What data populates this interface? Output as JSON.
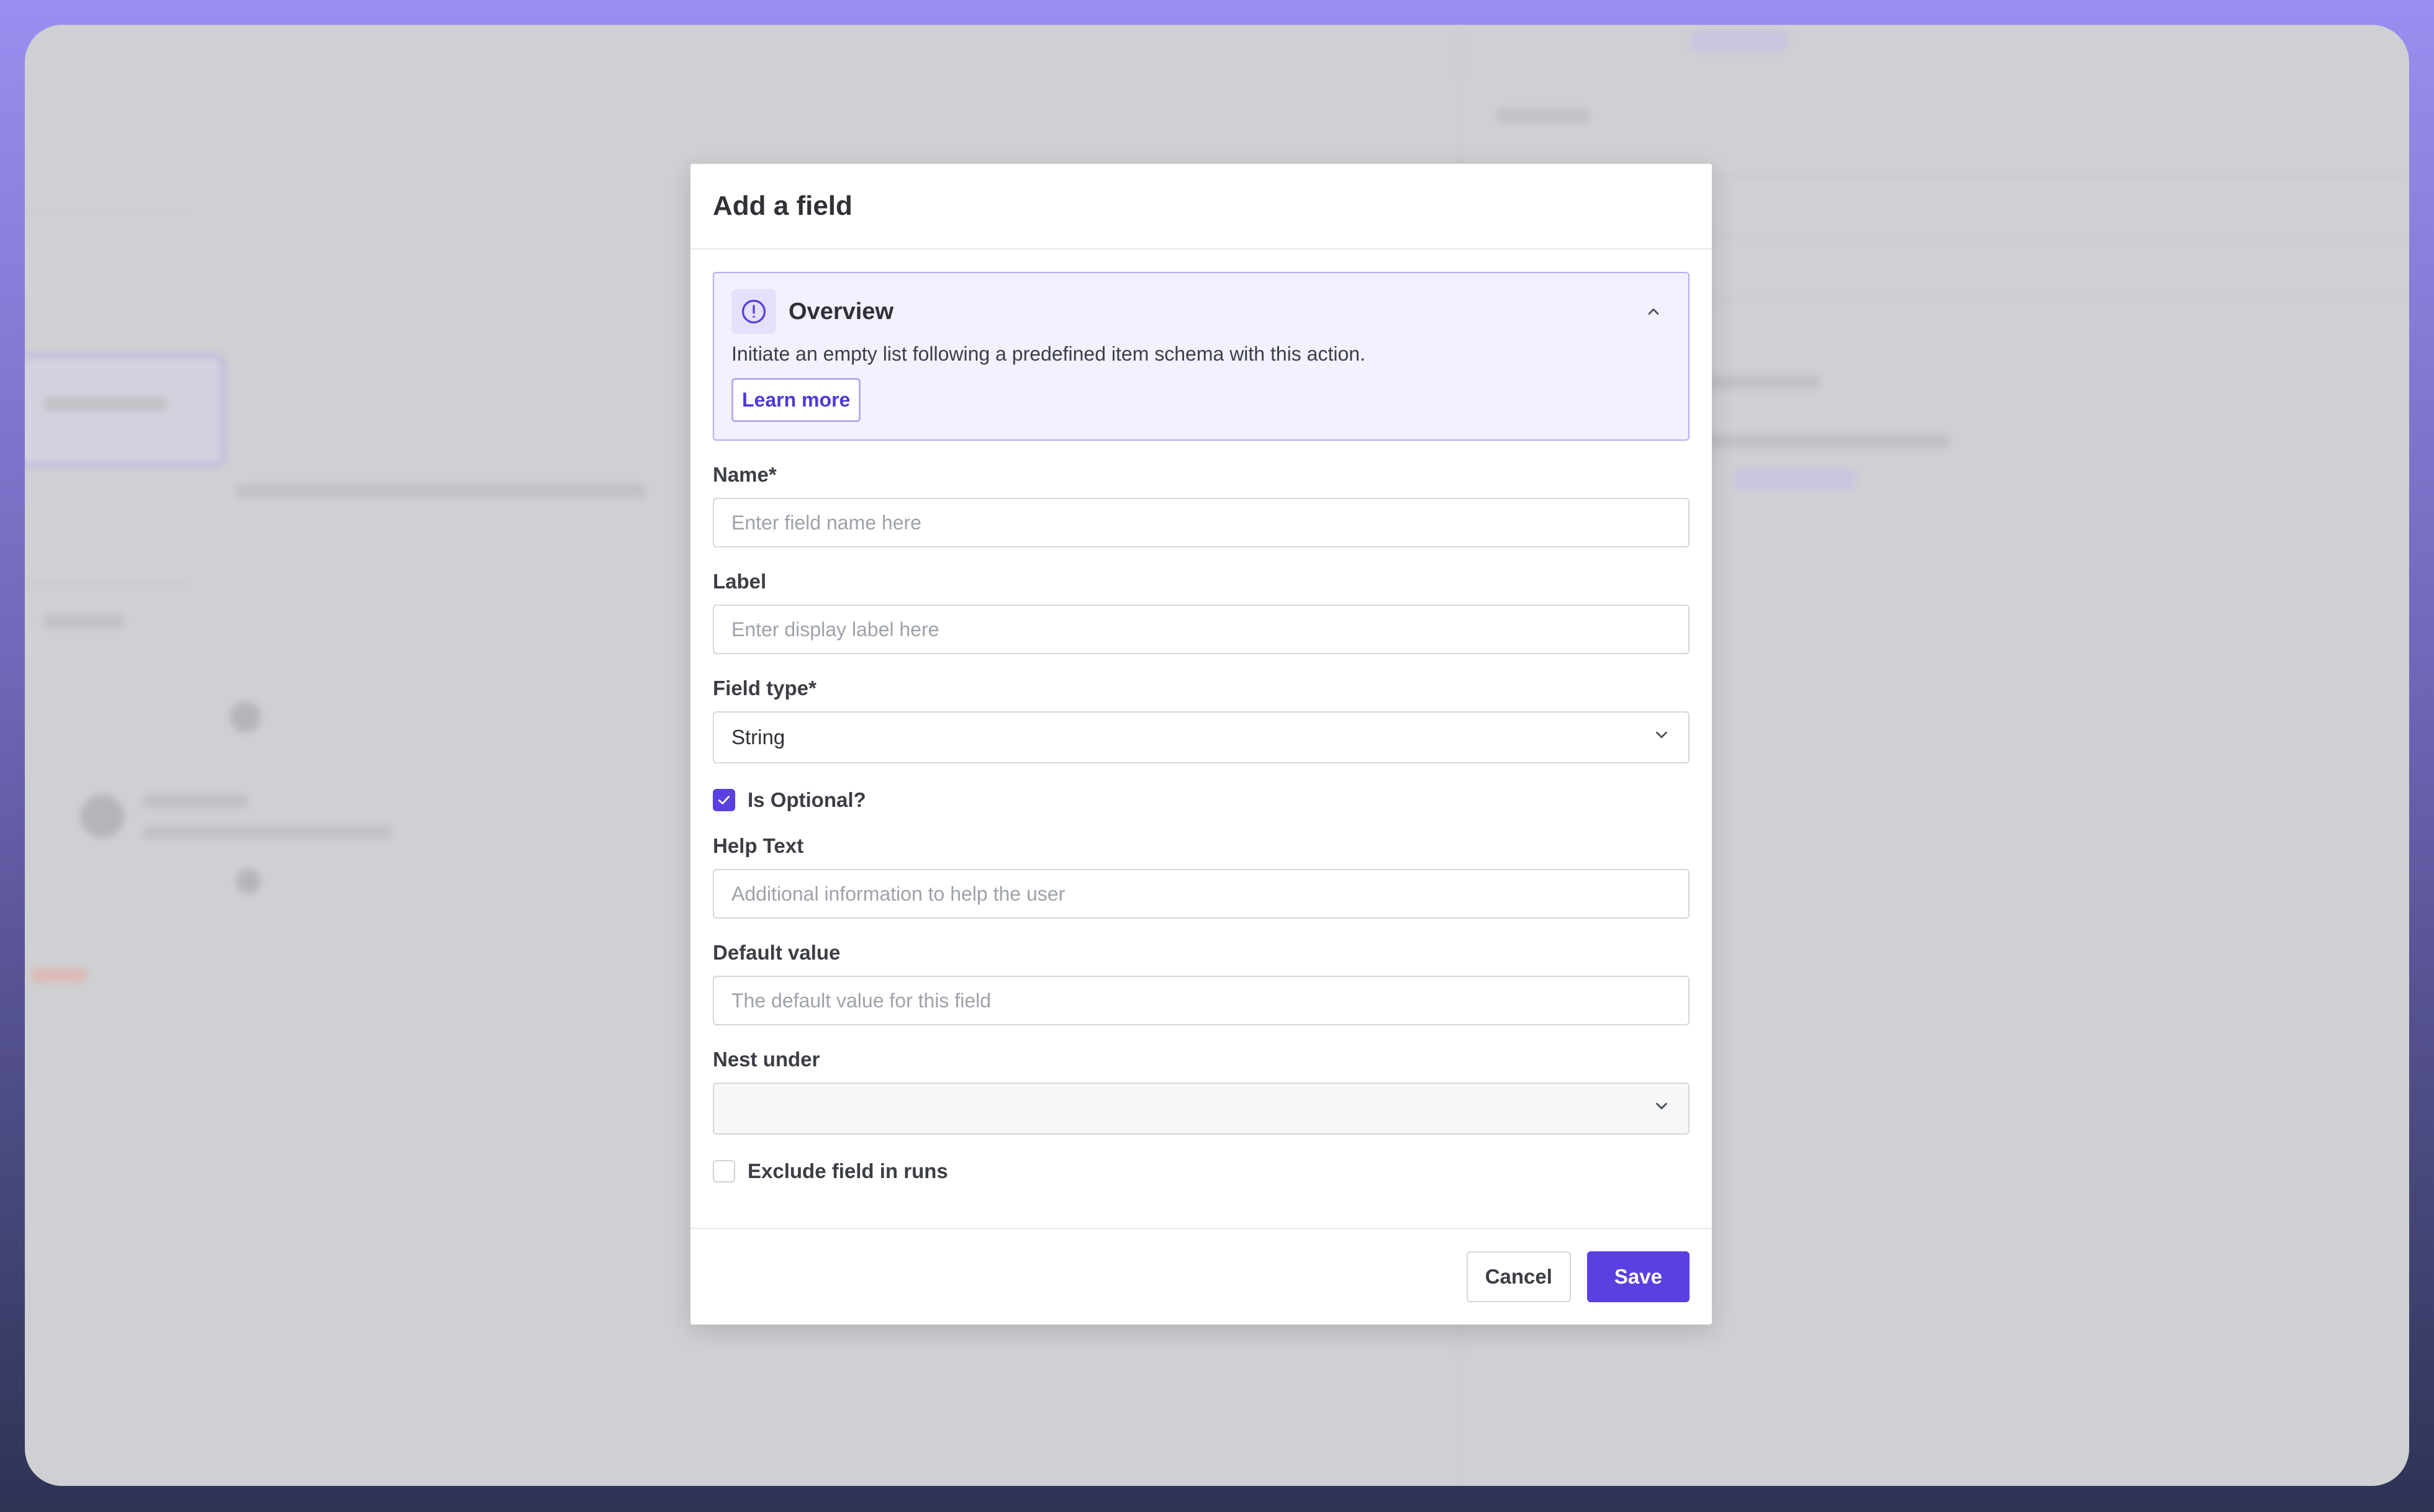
{
  "modal": {
    "title": "Add a field"
  },
  "overview": {
    "title": "Overview",
    "description": "Initiate an empty list following a predefined item schema with this action.",
    "learn_more_label": "Learn more",
    "icon": "info-circle-icon"
  },
  "fields": {
    "name": {
      "label": "Name*",
      "placeholder": "Enter field name here",
      "value": ""
    },
    "label": {
      "label": "Label",
      "placeholder": "Enter display label here",
      "value": ""
    },
    "field_type": {
      "label": "Field type*",
      "selected": "String"
    },
    "is_optional": {
      "label": "Is Optional?",
      "checked": true
    },
    "help_text": {
      "label": "Help Text",
      "placeholder": "Additional information to help the user",
      "value": ""
    },
    "default_value": {
      "label": "Default value",
      "placeholder": "The default value for this field",
      "value": ""
    },
    "nest_under": {
      "label": "Nest under",
      "selected": ""
    },
    "exclude_in_runs": {
      "label": "Exclude field in runs",
      "checked": false
    }
  },
  "footer": {
    "cancel_label": "Cancel",
    "save_label": "Save"
  },
  "colors": {
    "accent": "#5b3fe0",
    "overview_bg": "#f2f1ff",
    "overview_border": "#b6adf0"
  }
}
